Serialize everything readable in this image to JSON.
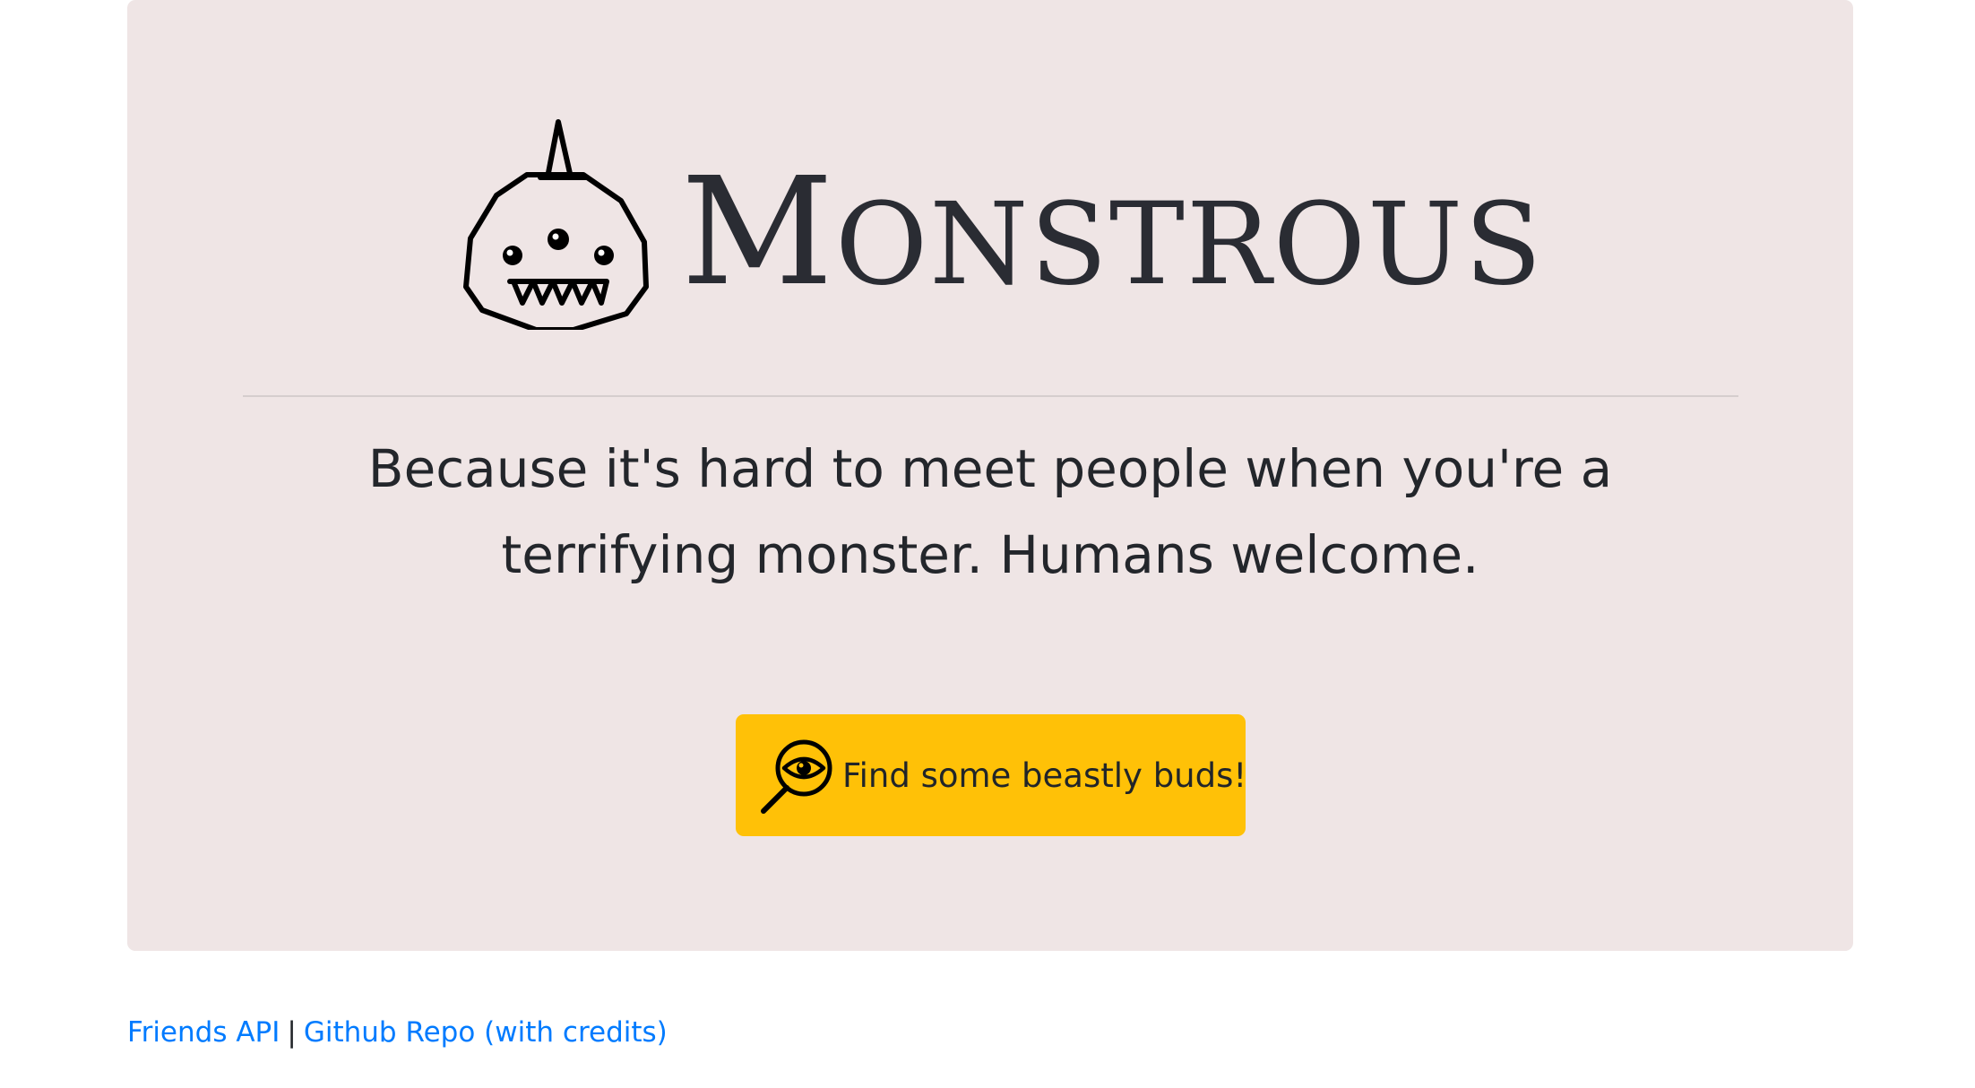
{
  "brand": {
    "logo_icon": "monster-face-icon",
    "title_initial": "M",
    "title_rest": "ONSTROUS"
  },
  "hero": {
    "tagline": "Because it's hard to meet people when you're a terrifying monster. Humans welcome."
  },
  "cta": {
    "icon": "eye-magnifier-icon",
    "label": "Find some beastly buds!"
  },
  "footer": {
    "links": [
      {
        "label": "Friends API"
      },
      {
        "label": "Github Repo (with credits)"
      }
    ],
    "separator": "|"
  },
  "colors": {
    "jumbotron_background": "#efe5e5",
    "button_background": "#ffc107",
    "link": "#007bff",
    "text": "#212529"
  }
}
